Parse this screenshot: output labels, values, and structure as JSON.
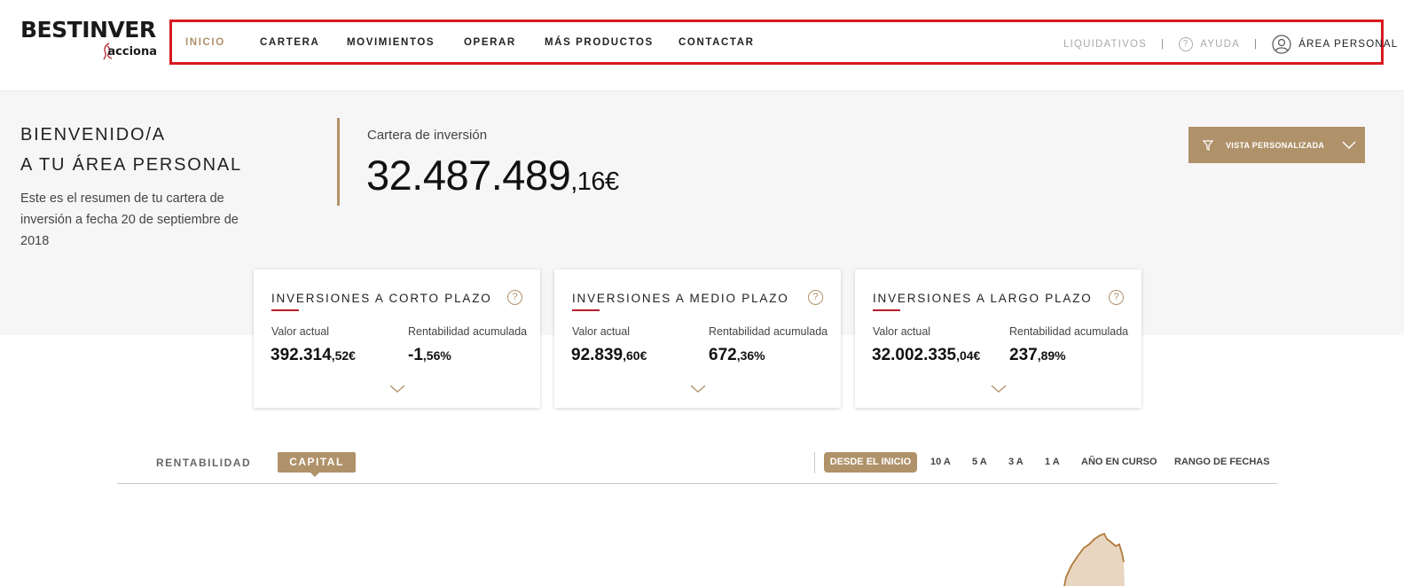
{
  "brand": {
    "name": "BESTINVER",
    "sub": "acciona"
  },
  "nav": {
    "items": [
      {
        "label": "INICIO",
        "active": true
      },
      {
        "label": "CARTERA"
      },
      {
        "label": "MOVIMIENTOS"
      },
      {
        "label": "OPERAR"
      },
      {
        "label": "MÁS PRODUCTOS"
      },
      {
        "label": "CONTACTAR"
      }
    ],
    "liquidativos": "LIQUIDATIVOS",
    "ayuda": "AYUDA",
    "area_personal": "ÁREA PERSONAL",
    "separator": "|"
  },
  "welcome": {
    "line1": "BIENVENIDO/A",
    "line2": "A TU ÁREA PERSONAL",
    "summary": "Este es el resumen de tu cartera de inversión a fecha 20 de septiembre de 2018"
  },
  "cartera": {
    "label": "Cartera de inversión",
    "value_int": "32.487.489",
    "value_dec": ",16€"
  },
  "vista_button": {
    "label": "VISTA PERSONALIZADA"
  },
  "cards": [
    {
      "title": "INVERSIONES A CORTO PLAZO",
      "valor_label": "Valor actual",
      "valor_int": "392.314",
      "valor_dec": ",52€",
      "rent_label": "Rentabilidad acumulada",
      "rent_int": "-1",
      "rent_dec": ",56%"
    },
    {
      "title": "INVERSIONES A MEDIO PLAZO",
      "valor_label": "Valor actual",
      "valor_int": "92.839",
      "valor_dec": ",60€",
      "rent_label": "Rentabilidad acumulada",
      "rent_int": "672",
      "rent_dec": ",36%"
    },
    {
      "title": "INVERSIONES A LARGO PLAZO",
      "valor_label": "Valor actual",
      "valor_int": "32.002.335",
      "valor_dec": ",04€",
      "rent_label": "Rentabilidad acumulada",
      "rent_int": "237",
      "rent_dec": ",89%"
    }
  ],
  "help_glyph": "?",
  "tabs": {
    "rentabilidad": "RENTABILIDAD",
    "capital": "CAPITAL"
  },
  "ranges": {
    "active": "DESDE EL INICIO",
    "items": [
      "10 A",
      "5 A",
      "3 A",
      "1 A",
      "AÑO EN CURSO",
      "RANGO DE FECHAS"
    ]
  },
  "colors": {
    "accent": "#b0926a",
    "highlight_border": "#d71920",
    "rule": "#b11f2a",
    "band": "#f6f6f6"
  }
}
